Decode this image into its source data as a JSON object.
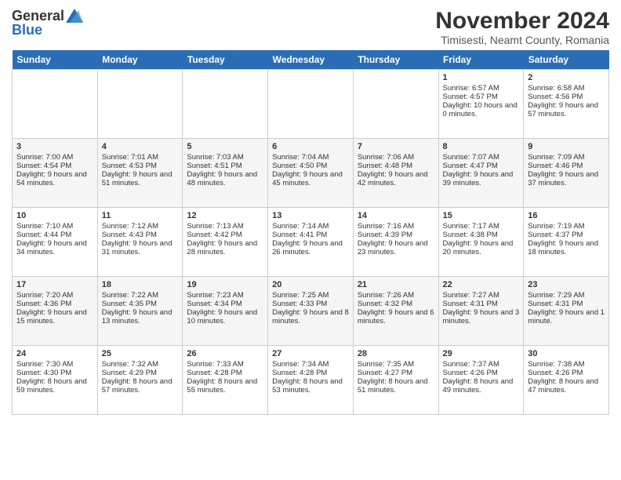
{
  "header": {
    "logo_general": "General",
    "logo_blue": "Blue",
    "main_title": "November 2024",
    "subtitle": "Timisesti, Neamt County, Romania"
  },
  "days_of_week": [
    "Sunday",
    "Monday",
    "Tuesday",
    "Wednesday",
    "Thursday",
    "Friday",
    "Saturday"
  ],
  "weeks": [
    {
      "days": [
        {
          "num": "",
          "data": ""
        },
        {
          "num": "",
          "data": ""
        },
        {
          "num": "",
          "data": ""
        },
        {
          "num": "",
          "data": ""
        },
        {
          "num": "",
          "data": ""
        },
        {
          "num": "1",
          "data": "Sunrise: 6:57 AM\nSunset: 4:57 PM\nDaylight: 10 hours and 0 minutes."
        },
        {
          "num": "2",
          "data": "Sunrise: 6:58 AM\nSunset: 4:56 PM\nDaylight: 9 hours and 57 minutes."
        }
      ]
    },
    {
      "days": [
        {
          "num": "3",
          "data": "Sunrise: 7:00 AM\nSunset: 4:54 PM\nDaylight: 9 hours and 54 minutes."
        },
        {
          "num": "4",
          "data": "Sunrise: 7:01 AM\nSunset: 4:53 PM\nDaylight: 9 hours and 51 minutes."
        },
        {
          "num": "5",
          "data": "Sunrise: 7:03 AM\nSunset: 4:51 PM\nDaylight: 9 hours and 48 minutes."
        },
        {
          "num": "6",
          "data": "Sunrise: 7:04 AM\nSunset: 4:50 PM\nDaylight: 9 hours and 45 minutes."
        },
        {
          "num": "7",
          "data": "Sunrise: 7:06 AM\nSunset: 4:48 PM\nDaylight: 9 hours and 42 minutes."
        },
        {
          "num": "8",
          "data": "Sunrise: 7:07 AM\nSunset: 4:47 PM\nDaylight: 9 hours and 39 minutes."
        },
        {
          "num": "9",
          "data": "Sunrise: 7:09 AM\nSunset: 4:46 PM\nDaylight: 9 hours and 37 minutes."
        }
      ]
    },
    {
      "days": [
        {
          "num": "10",
          "data": "Sunrise: 7:10 AM\nSunset: 4:44 PM\nDaylight: 9 hours and 34 minutes."
        },
        {
          "num": "11",
          "data": "Sunrise: 7:12 AM\nSunset: 4:43 PM\nDaylight: 9 hours and 31 minutes."
        },
        {
          "num": "12",
          "data": "Sunrise: 7:13 AM\nSunset: 4:42 PM\nDaylight: 9 hours and 28 minutes."
        },
        {
          "num": "13",
          "data": "Sunrise: 7:14 AM\nSunset: 4:41 PM\nDaylight: 9 hours and 26 minutes."
        },
        {
          "num": "14",
          "data": "Sunrise: 7:16 AM\nSunset: 4:39 PM\nDaylight: 9 hours and 23 minutes."
        },
        {
          "num": "15",
          "data": "Sunrise: 7:17 AM\nSunset: 4:38 PM\nDaylight: 9 hours and 20 minutes."
        },
        {
          "num": "16",
          "data": "Sunrise: 7:19 AM\nSunset: 4:37 PM\nDaylight: 9 hours and 18 minutes."
        }
      ]
    },
    {
      "days": [
        {
          "num": "17",
          "data": "Sunrise: 7:20 AM\nSunset: 4:36 PM\nDaylight: 9 hours and 15 minutes."
        },
        {
          "num": "18",
          "data": "Sunrise: 7:22 AM\nSunset: 4:35 PM\nDaylight: 9 hours and 13 minutes."
        },
        {
          "num": "19",
          "data": "Sunrise: 7:23 AM\nSunset: 4:34 PM\nDaylight: 9 hours and 10 minutes."
        },
        {
          "num": "20",
          "data": "Sunrise: 7:25 AM\nSunset: 4:33 PM\nDaylight: 9 hours and 8 minutes."
        },
        {
          "num": "21",
          "data": "Sunrise: 7:26 AM\nSunset: 4:32 PM\nDaylight: 9 hours and 6 minutes."
        },
        {
          "num": "22",
          "data": "Sunrise: 7:27 AM\nSunset: 4:31 PM\nDaylight: 9 hours and 3 minutes."
        },
        {
          "num": "23",
          "data": "Sunrise: 7:29 AM\nSunset: 4:31 PM\nDaylight: 9 hours and 1 minute."
        }
      ]
    },
    {
      "days": [
        {
          "num": "24",
          "data": "Sunrise: 7:30 AM\nSunset: 4:30 PM\nDaylight: 8 hours and 59 minutes."
        },
        {
          "num": "25",
          "data": "Sunrise: 7:32 AM\nSunset: 4:29 PM\nDaylight: 8 hours and 57 minutes."
        },
        {
          "num": "26",
          "data": "Sunrise: 7:33 AM\nSunset: 4:28 PM\nDaylight: 8 hours and 55 minutes."
        },
        {
          "num": "27",
          "data": "Sunrise: 7:34 AM\nSunset: 4:28 PM\nDaylight: 8 hours and 53 minutes."
        },
        {
          "num": "28",
          "data": "Sunrise: 7:35 AM\nSunset: 4:27 PM\nDaylight: 8 hours and 51 minutes."
        },
        {
          "num": "29",
          "data": "Sunrise: 7:37 AM\nSunset: 4:26 PM\nDaylight: 8 hours and 49 minutes."
        },
        {
          "num": "30",
          "data": "Sunrise: 7:38 AM\nSunset: 4:26 PM\nDaylight: 8 hours and 47 minutes."
        }
      ]
    }
  ]
}
